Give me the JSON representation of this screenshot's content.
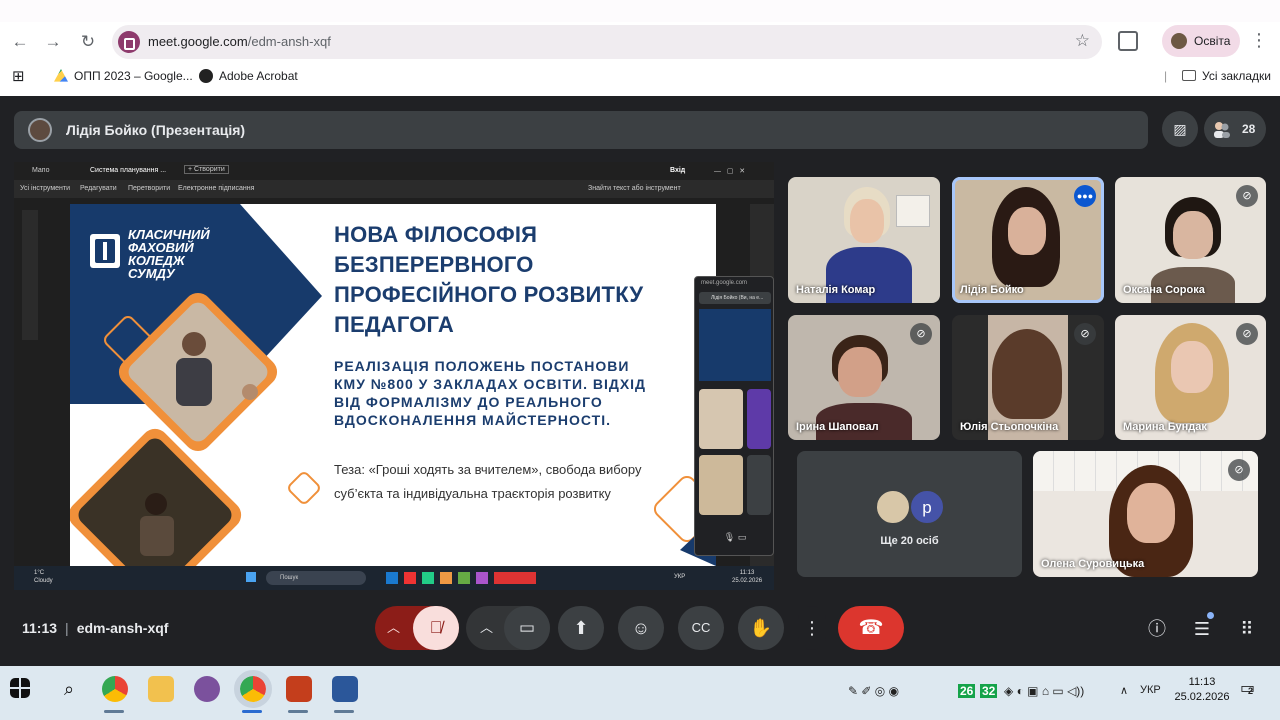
{
  "browser": {
    "url_host": "meet.google.com",
    "url_path": "/edm-ansh-xqf",
    "profile_name": "Освіта",
    "bookmarks": [
      "ОПП 2023 – Google...",
      "Adobe Acrobat"
    ],
    "all_bookmarks": "Усі закладки"
  },
  "meet": {
    "presenter_title": "Лідія Бойко (Презентація)",
    "participant_count": "28",
    "time": "11:13",
    "meeting_code": "edm-ansh-xqf",
    "more_people": "Ще 20 осіб",
    "more_avatar_letter": "р",
    "participants": [
      {
        "name": "Наталія Комар",
        "muted": false,
        "speaking": false
      },
      {
        "name": "Лідія Бойко",
        "muted": false,
        "speaking": true
      },
      {
        "name": "Оксана Сорока",
        "muted": true,
        "speaking": false
      },
      {
        "name": "Ірина Шаповал",
        "muted": true,
        "speaking": false
      },
      {
        "name": "Юлія Стьопочкіна",
        "muted": true,
        "speaking": false
      },
      {
        "name": "Марина Бундак",
        "muted": true,
        "speaking": false
      },
      {
        "name": "Олена Суровицька",
        "muted": true,
        "speaking": false
      }
    ]
  },
  "shared_screen": {
    "tabs": [
      "Мапо",
      "Система планування ...",
      "+ Створити"
    ],
    "top_right": "Вхід",
    "tools": [
      "Усі інструменти",
      "Редагувати",
      "Перетворити",
      "Електронне підписання"
    ],
    "search": "Знайти текст або інструмент",
    "pip_url": "meet.google.com",
    "pip_presenter": "Лідія Бойко (Ви, на е...",
    "taskbar_weather_temp": "1°C",
    "taskbar_weather": "Cloudy",
    "taskbar_search": "Пошук",
    "taskbar_lang": "УКР",
    "taskbar_time": "11:13",
    "taskbar_date": "25.02.2026"
  },
  "slide": {
    "logo_lines": [
      "КЛАСИЧНИЙ",
      "ФАХОВИЙ",
      "КОЛЕДЖ",
      "СУМДУ"
    ],
    "title_lines": [
      "НОВА ФІЛОСОФІЯ",
      "БЕЗПЕРЕРВНОГО",
      "ПРОФЕСІЙНОГО РОЗВИТКУ",
      "ПЕДАГОГА"
    ],
    "subtitle_lines": [
      "РЕАЛІЗАЦІЯ ПОЛОЖЕНЬ ПОСТАНОВИ",
      "КМУ №800 У ЗАКЛАДАХ ОСВІТИ. ВІДХІД",
      "ВІД ФОРМАЛІЗМУ ДО РЕАЛЬНОГО",
      "ВДОСКОНАЛЕННЯ МАЙСТЕРНОСТІ."
    ],
    "body_lines": [
      "Теза: «Гроші ходять за вчителем», свобода вибору",
      "суб’єкта та індивідуальна траєкторія розвитку"
    ]
  },
  "taskbar": {
    "time": "11:13",
    "date": "25.02.2026",
    "lang": "УКР",
    "badge1": "26",
    "badge2": "32",
    "notifications": "2"
  },
  "colors": {
    "meet_bg": "#202124",
    "end_call": "#dc362e",
    "slide_navy": "#1b3d6e",
    "slide_orange": "#f0903a"
  }
}
